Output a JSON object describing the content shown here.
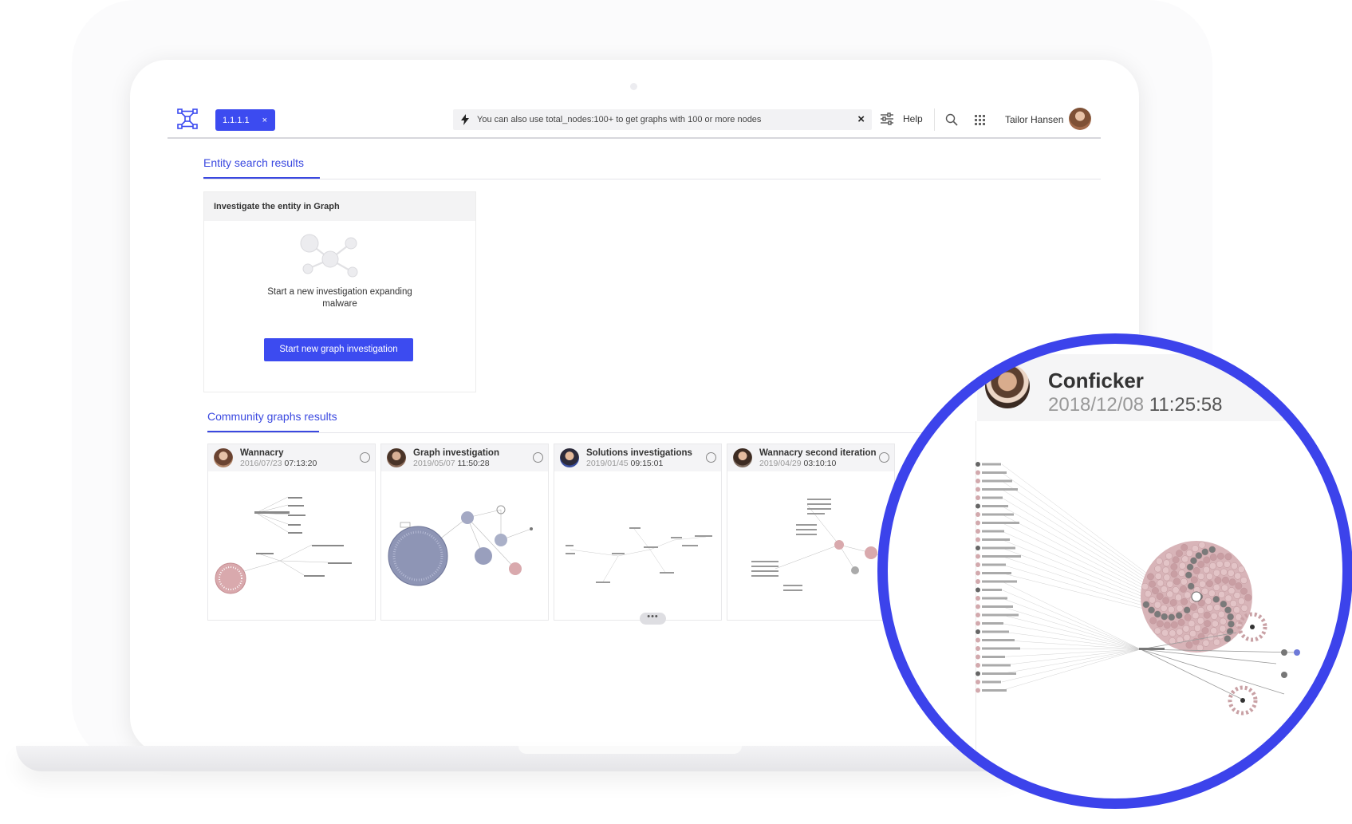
{
  "topbar": {
    "query_chip": "1.1.1.1",
    "chip_close": "×",
    "search_hint": "You can also use total_nodes:100+ to get graphs with 100 or more nodes",
    "search_clear": "×",
    "help_label": "Help",
    "user_name": "Tailor Hansen"
  },
  "entity_tab": {
    "label": "Entity search results"
  },
  "investigate_card": {
    "header": "Investigate the entity in Graph",
    "description": "Start a new investigation expanding malware",
    "button_label": "Start new graph investigation"
  },
  "community_tab": {
    "label": "Community graphs results"
  },
  "graphs": [
    {
      "title": "Wannacry",
      "date": "2016/07/23",
      "time": "07:13:20"
    },
    {
      "title": "Graph investigation",
      "date": "2019/05/07",
      "time": "11:50:28"
    },
    {
      "title": "Solutions investigations",
      "date": "2019/01/45",
      "time": "09:15:01"
    },
    {
      "title": "Wannacry second iteration",
      "date": "2019/04/29",
      "time": "03:10:10"
    }
  ],
  "more_label": "•••",
  "zoom": {
    "title": "Conficker",
    "date": "2018/12/08",
    "time": "11:25:58"
  },
  "colors": {
    "accent": "#3c4bf0",
    "ring": "#3c43eb",
    "node_pink": "#d8b4b8"
  }
}
